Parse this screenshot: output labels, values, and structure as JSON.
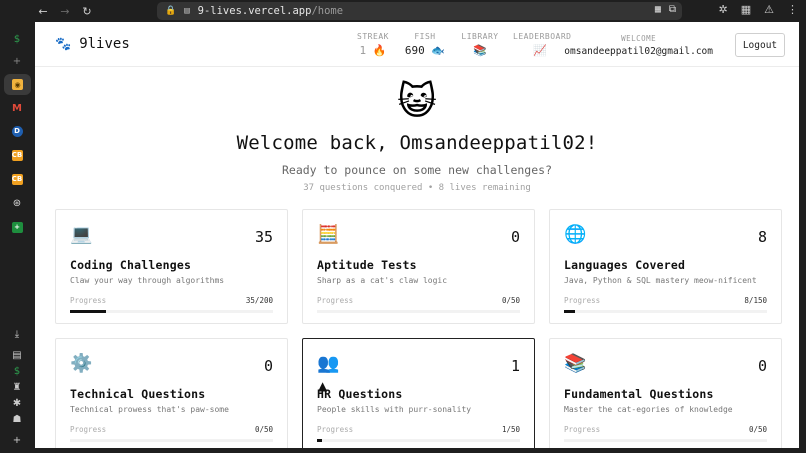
{
  "browser": {
    "url_host": "9-lives.vercel.app",
    "url_path": "/home",
    "nav": {
      "back": "←",
      "forward": "→",
      "reload": "↻"
    }
  },
  "dock": {
    "items": [
      "dollar-icon",
      "plus-icon",
      "cat-app-icon",
      "gmail-icon",
      "d-app-icon",
      "cb-app-icon",
      "cb-app-icon-2",
      "chatgpt-icon",
      "sheets-icon",
      "download-icon",
      "doc-icon",
      "dollar-icon-2",
      "lock-icon",
      "gear-icon",
      "ghost-icon",
      "plus-icon-2"
    ]
  },
  "header": {
    "logo_text": "9lives",
    "logo_icon": "🐾",
    "stats": [
      {
        "label": "STREAK",
        "value": "1",
        "icon": "🔥"
      },
      {
        "label": "FISH",
        "value": "690",
        "icon": "🐟"
      },
      {
        "label": "LIBRARY",
        "value": "",
        "icon": "📚"
      },
      {
        "label": "LEADERBOARD",
        "value": "",
        "icon": "📈"
      }
    ],
    "welcome_label": "WELCOME",
    "email": "omsandeeppatil02@gmail.com",
    "logout_label": "Logout"
  },
  "hero": {
    "emoji": "😺",
    "title": "Welcome back, Omsandeeppatil02!",
    "subtitle": "Ready to pounce on some new challenges?",
    "summary": "37 questions conquered • 8 lives remaining"
  },
  "cards": [
    {
      "icon": "💻",
      "count": "35",
      "title": "Coding Challenges",
      "desc": "Claw your way through algorithms",
      "progress_label": "Progress",
      "progress_text": "35/200",
      "progress": 0.175
    },
    {
      "icon": "🧮",
      "count": "0",
      "title": "Aptitude Tests",
      "desc": "Sharp as a cat's claw logic",
      "progress_label": "Progress",
      "progress_text": "0/50",
      "progress": 0
    },
    {
      "icon": "🌐",
      "count": "8",
      "title": "Languages Covered",
      "desc": "Java, Python & SQL mastery meow-nificent",
      "progress_label": "Progress",
      "progress_text": "8/150",
      "progress": 0.053
    },
    {
      "icon": "⚙️",
      "count": "0",
      "title": "Technical Questions",
      "desc": "Technical prowess that's paw-some",
      "progress_label": "Progress",
      "progress_text": "0/50",
      "progress": 0
    },
    {
      "icon": "👥",
      "count": "1",
      "title": "HR Questions",
      "desc": "People skills with purr-sonality",
      "progress_label": "Progress",
      "progress_text": "1/50",
      "progress": 0.02
    },
    {
      "icon": "📚",
      "count": "0",
      "title": "Fundamental Questions",
      "desc": "Master the cat-egories of knowledge",
      "progress_label": "Progress",
      "progress_text": "0/50",
      "progress": 0
    }
  ]
}
